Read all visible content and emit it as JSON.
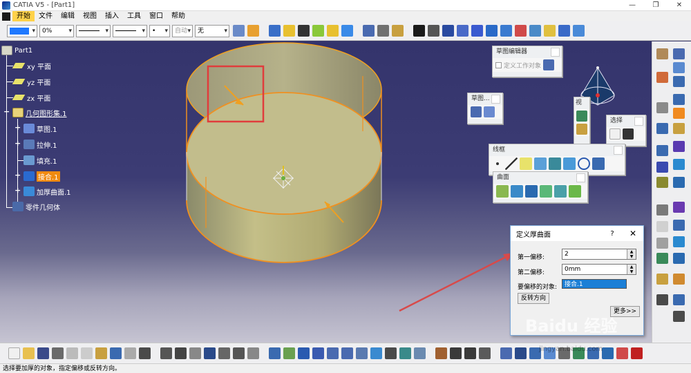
{
  "window": {
    "title": "CATIA V5 - [Part1]",
    "controls": [
      "—",
      "❐",
      "✕"
    ]
  },
  "menu": {
    "items": [
      "开始",
      "文件",
      "编辑",
      "视图",
      "插入",
      "工具",
      "窗口",
      "帮助"
    ]
  },
  "toolbar_top": {
    "transparency": "0%",
    "point_style": "•",
    "layer": "自动",
    "layer_filter": "无"
  },
  "tree": {
    "root": "Part1",
    "xy_plane": "xy 平面",
    "yz_plane": "yz 平面",
    "zx_plane": "zx 平面",
    "geo_set": "几何图形集.1",
    "sketch": "草图.1",
    "extrude": "拉伸.1",
    "fill": "填充.1",
    "join": "接合.1",
    "thick_surface": "加厚曲面.1",
    "part_body": "零件几何体"
  },
  "floating_toolbars": {
    "sketcher": {
      "title": "草图编辑器",
      "label": "定义工作对象"
    },
    "sketch_small": {
      "title": "草图..."
    },
    "tiny": {
      "title": "视"
    },
    "select": {
      "title": "选择"
    },
    "wireframe": {
      "title": "线框"
    },
    "surfaces": {
      "title": "曲面"
    }
  },
  "dialog": {
    "title": "定义厚曲面",
    "help": "?",
    "close": "✕",
    "first_offset_label": "第一偏移:",
    "first_offset_value": "2",
    "second_offset_label": "第二偏移:",
    "second_offset_value": "0mm",
    "object_label": "要偏移的对象:",
    "object_value": "接合.1",
    "reverse_button": "反转方向",
    "more_button": "更多>>"
  },
  "statusbar": {
    "text": "选择要加厚的对象，指定偏移或反转方向。"
  },
  "watermark": {
    "text": "Baidu 经验",
    "url": "jingyan.baidu.com"
  },
  "colors": {
    "accent": "#f08a10",
    "viewport_top": "#34346c",
    "cylinder": "#b4ae6a",
    "highlight_box": "#e03c3c"
  }
}
